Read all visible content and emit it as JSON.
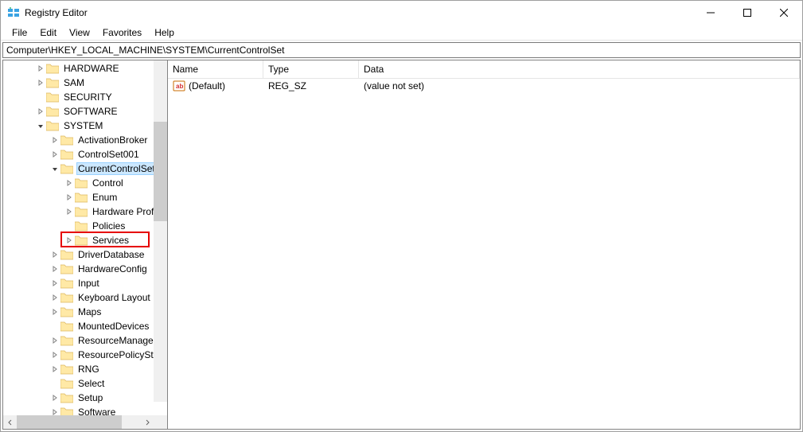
{
  "window": {
    "title": "Registry Editor"
  },
  "menu": {
    "file": "File",
    "edit": "Edit",
    "view": "View",
    "favorites": "Favorites",
    "help": "Help"
  },
  "address": "Computer\\HKEY_LOCAL_MACHINE\\SYSTEM\\CurrentControlSet",
  "tree": {
    "hardware": "HARDWARE",
    "sam": "SAM",
    "security": "SECURITY",
    "software": "SOFTWARE",
    "system": "SYSTEM",
    "activation_broker": "ActivationBroker",
    "controlset001": "ControlSet001",
    "currentcontrolset": "CurrentControlSet",
    "control": "Control",
    "enum": "Enum",
    "hardware_profiles": "Hardware Profiles",
    "policies": "Policies",
    "services": "Services",
    "driver_database": "DriverDatabase",
    "hardware_config": "HardwareConfig",
    "input": "Input",
    "keyboard_layout": "Keyboard Layout",
    "maps": "Maps",
    "mounted_devices": "MountedDevices",
    "resource_manager": "ResourceManager",
    "resource_policy_store": "ResourcePolicyStore",
    "rng": "RNG",
    "select": "Select",
    "setup": "Setup",
    "software2": "Software"
  },
  "columns": {
    "name": "Name",
    "type": "Type",
    "data": "Data"
  },
  "values": [
    {
      "name": "(Default)",
      "type": "REG_SZ",
      "data": "(value not set)"
    }
  ]
}
